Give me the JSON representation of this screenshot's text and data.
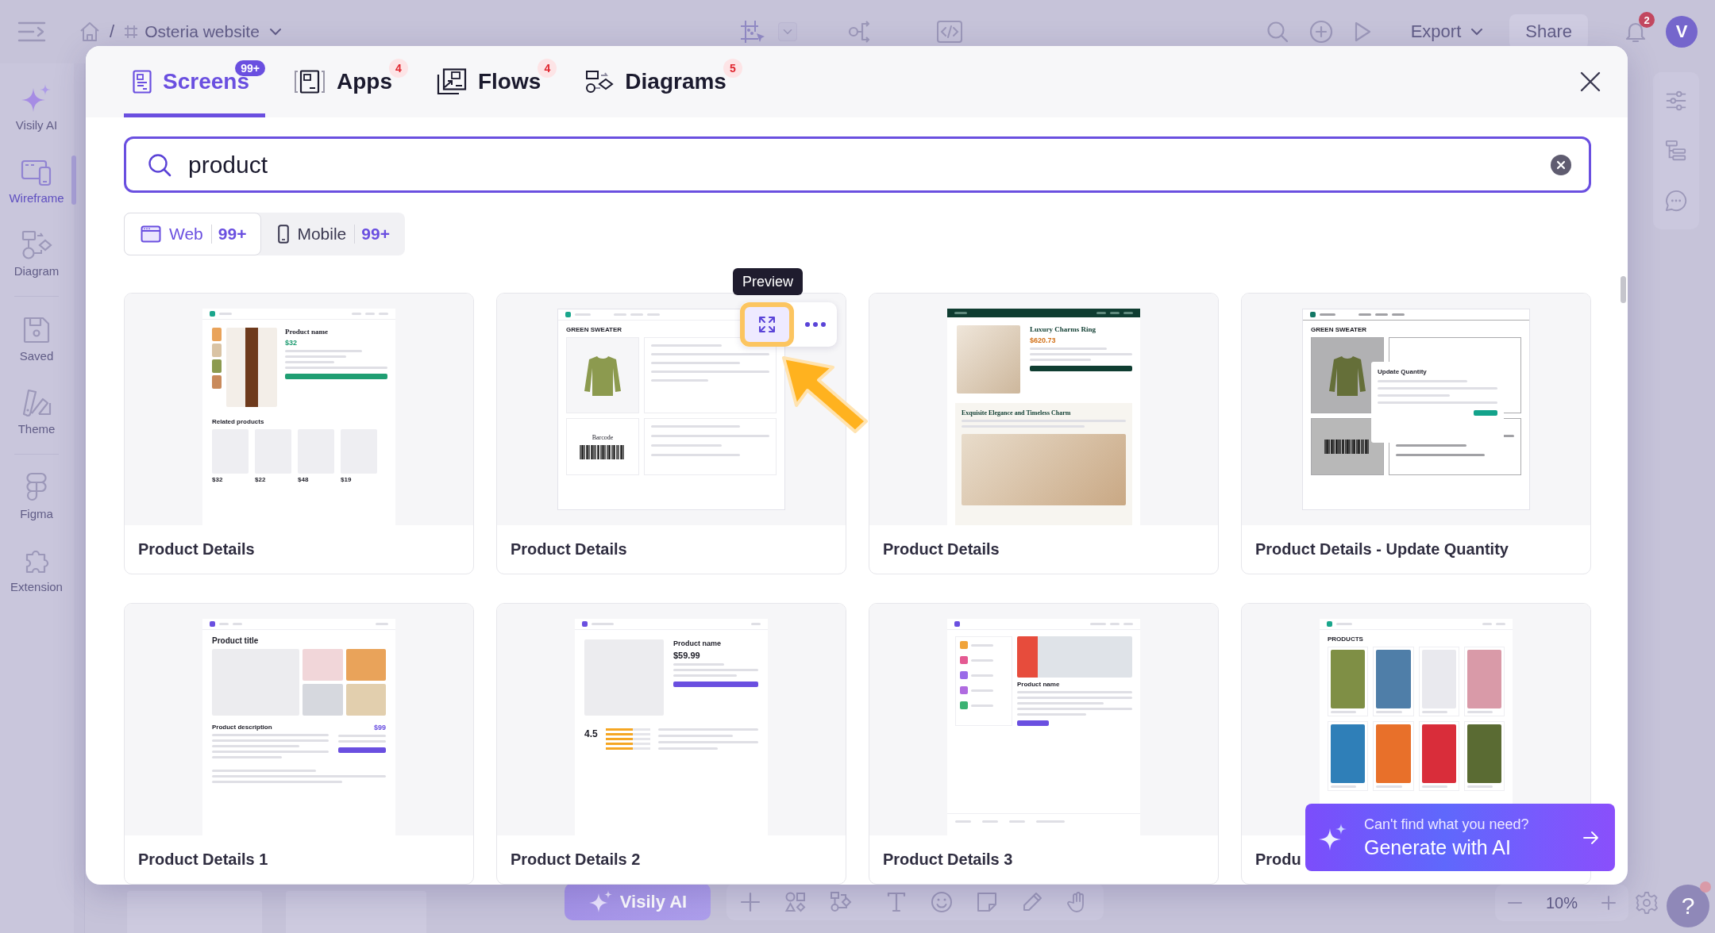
{
  "app_bar": {
    "breadcrumb_separator": "/",
    "project": "Osteria website",
    "modes": [
      {
        "kind": "frame",
        "selected": true
      },
      {
        "kind": "flow",
        "selected": false
      },
      {
        "kind": "code",
        "selected": false
      }
    ],
    "export": "Export",
    "share": "Share",
    "notifications": "2",
    "avatar": "V"
  },
  "sidebar": {
    "groups": [
      {
        "items": [
          {
            "label": "Visily AI",
            "kind": "ai",
            "selected": false
          },
          {
            "label": "Wireframe",
            "kind": "wireframe",
            "selected": true
          },
          {
            "label": "Diagram",
            "kind": "diagram",
            "selected": false
          }
        ]
      },
      {
        "items": [
          {
            "label": "Saved",
            "kind": "saved",
            "selected": false
          },
          {
            "label": "Theme",
            "kind": "theme",
            "selected": false
          }
        ]
      },
      {
        "items": [
          {
            "label": "Figma",
            "kind": "figma",
            "selected": false
          },
          {
            "label": "Extension",
            "kind": "extension",
            "selected": false
          }
        ]
      }
    ]
  },
  "canvas_toolbar": {
    "ai_button": "Visily AI",
    "zoom": "10%",
    "help": "?"
  },
  "dialog": {
    "tabs": [
      {
        "label": "Screens",
        "kind": "screens",
        "badge": "99+",
        "selected": true
      },
      {
        "label": "Apps",
        "kind": "apps",
        "badge": "4",
        "selected": false
      },
      {
        "label": "Flows",
        "kind": "flows",
        "badge": "4",
        "selected": false
      },
      {
        "label": "Diagrams",
        "kind": "diagrams",
        "badge": "5",
        "selected": false
      }
    ],
    "search": {
      "value": "product"
    },
    "filters": [
      {
        "label": "Web",
        "kind": "web",
        "count": "99+",
        "selected": true
      },
      {
        "label": "Mobile",
        "kind": "mobile",
        "count": "99+",
        "selected": false
      }
    ],
    "cards": [
      {
        "title": "Product Details",
        "hovered": false,
        "thumbnail": {
          "kind": "detail",
          "heading": "Product name",
          "price": "$32",
          "section": "Related products",
          "tiles": [
            "$32",
            "$22",
            "$48",
            "$19"
          ]
        }
      },
      {
        "title": "Product Details",
        "hovered": true,
        "tooltip": "Preview",
        "thumbnail": {
          "kind": "inventory",
          "heading": "GREEN SWEATER",
          "section": "Barcode"
        }
      },
      {
        "title": "Product Details",
        "hovered": false,
        "thumbnail": {
          "kind": "jewelry",
          "heading": "Luxury Charms Ring",
          "price": "$620.73",
          "section": "Exquisite Elegance and Timeless Charm"
        }
      },
      {
        "title": "Product Details - Update Quantity",
        "hovered": false,
        "thumbnail": {
          "kind": "inventory",
          "heading": "GREEN SWEATER",
          "dialog": "Update Quantity"
        }
      },
      {
        "title": "Product Details 1",
        "hovered": false,
        "thumbnail": {
          "kind": "gallery",
          "heading": "Product title",
          "price": "$99",
          "section": "Product description"
        }
      },
      {
        "title": "Product Details 2",
        "hovered": false,
        "thumbnail": {
          "kind": "split",
          "heading": "Product name",
          "price": "$59.99",
          "rating": "4.5"
        }
      },
      {
        "title": "Product Details 3",
        "hovered": false,
        "thumbnail": {
          "kind": "list",
          "heading": "Product name"
        }
      },
      {
        "title": "Produ",
        "hovered": false,
        "thumbnail": {
          "kind": "grid",
          "heading": "PRODUCTS"
        }
      }
    ],
    "generate": {
      "prompt": "Can't find what you need?",
      "action": "Generate with AI"
    }
  }
}
